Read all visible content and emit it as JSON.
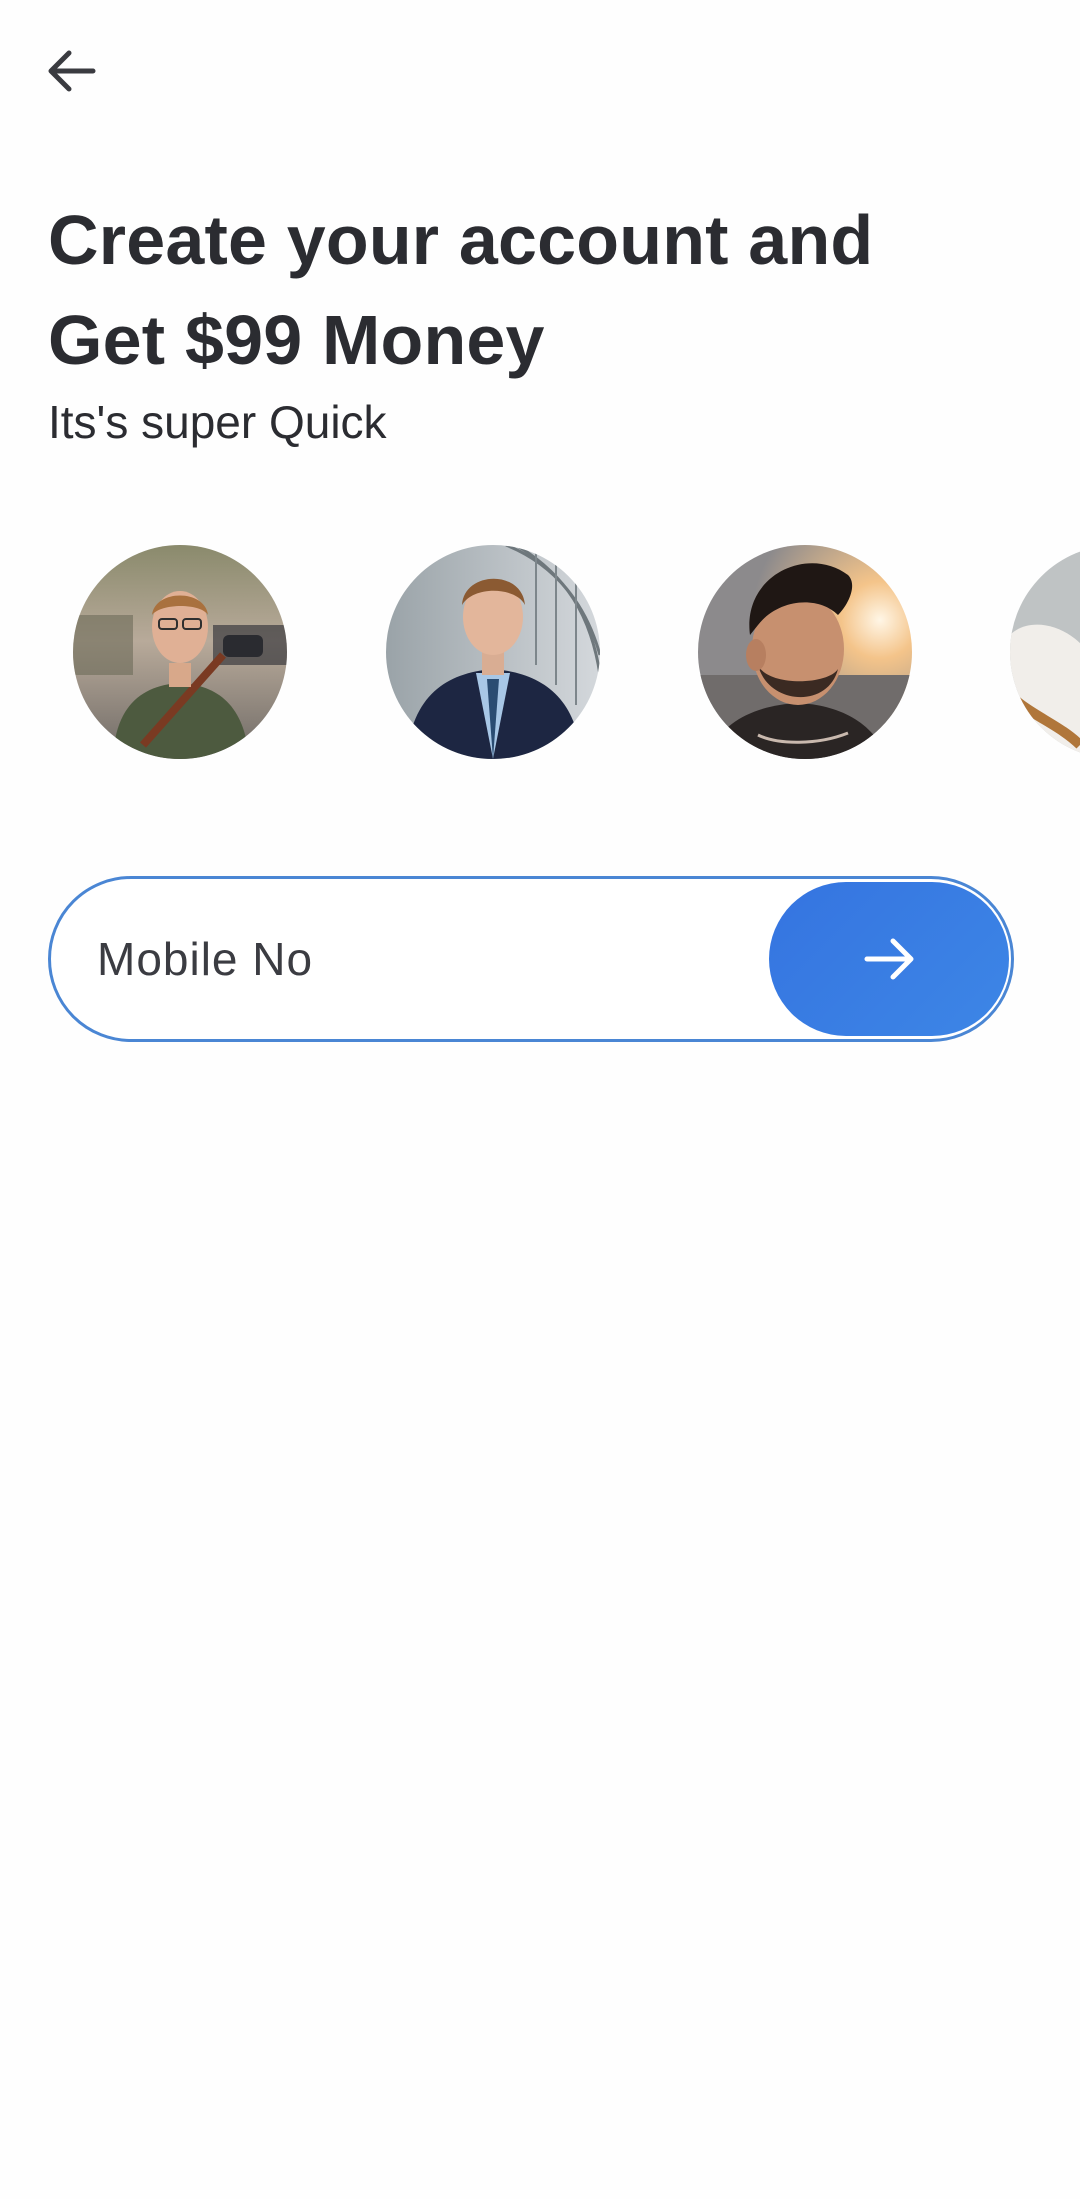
{
  "header": {
    "back_icon": "arrow-left-icon",
    "back_label": "Back"
  },
  "hero": {
    "title_line1": "Create your account and",
    "title_line2": "Get $99 Money",
    "subtitle": "Its's super Quick"
  },
  "avatars": [
    {
      "description": "man-glasses-green-sweater"
    },
    {
      "description": "man-navy-suit-blue-tie"
    },
    {
      "description": "man-beard-sunset"
    },
    {
      "description": "partial-avatar"
    }
  ],
  "form": {
    "mobile_placeholder": "Mobile No",
    "mobile_value": "",
    "submit_icon": "arrow-right-icon",
    "accent_color": "#3b7fe3",
    "border_color": "#4a86d4"
  },
  "colors": {
    "text": "#2b2c31",
    "background": "#fefefe"
  }
}
